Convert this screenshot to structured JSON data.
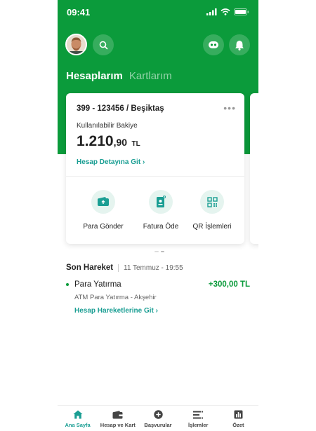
{
  "status_bar": {
    "time": "09:41"
  },
  "header": {
    "tabs": [
      {
        "label": "Hesaplarım",
        "active": true
      },
      {
        "label": "Kartlarım",
        "active": false
      }
    ]
  },
  "account_card": {
    "account": "399 - 123456 / Beşiktaş",
    "menu": "•••",
    "balance_label": "Kullanılabilir Bakiye",
    "balance_main": "1.210",
    "balance_cents": ",90",
    "currency": "TL",
    "detail_link": "Hesap Detayına Git",
    "actions": [
      {
        "label": "Para Gönder",
        "icon": "wallet-send-icon"
      },
      {
        "label": "Fatura Öde",
        "icon": "invoice-icon"
      },
      {
        "label": "QR İşlemleri",
        "icon": "qr-code-icon"
      }
    ]
  },
  "recent": {
    "title": "Son Hareket",
    "date": "11 Temmuz - 19:55",
    "transaction": {
      "name": "Para Yatırma",
      "amount": "+300,00 TL",
      "description": "ATM Para Yatırma - Akşehir"
    },
    "link": "Hesap Hareketlerine Git"
  },
  "bottom_nav": [
    {
      "label": "Ana Sayfa",
      "icon": "home-icon",
      "active": true
    },
    {
      "label": "Hesap ve Kart",
      "icon": "wallet-icon",
      "active": false
    },
    {
      "label": "Başvurular",
      "icon": "plus-circle-icon",
      "active": false
    },
    {
      "label": "İşlemler",
      "icon": "list-icon",
      "active": false
    },
    {
      "label": "Özet",
      "icon": "bar-chart-icon",
      "active": false
    }
  ],
  "colors": {
    "brand_green": "#0b9b3b",
    "accent_teal": "#1a9e93"
  }
}
